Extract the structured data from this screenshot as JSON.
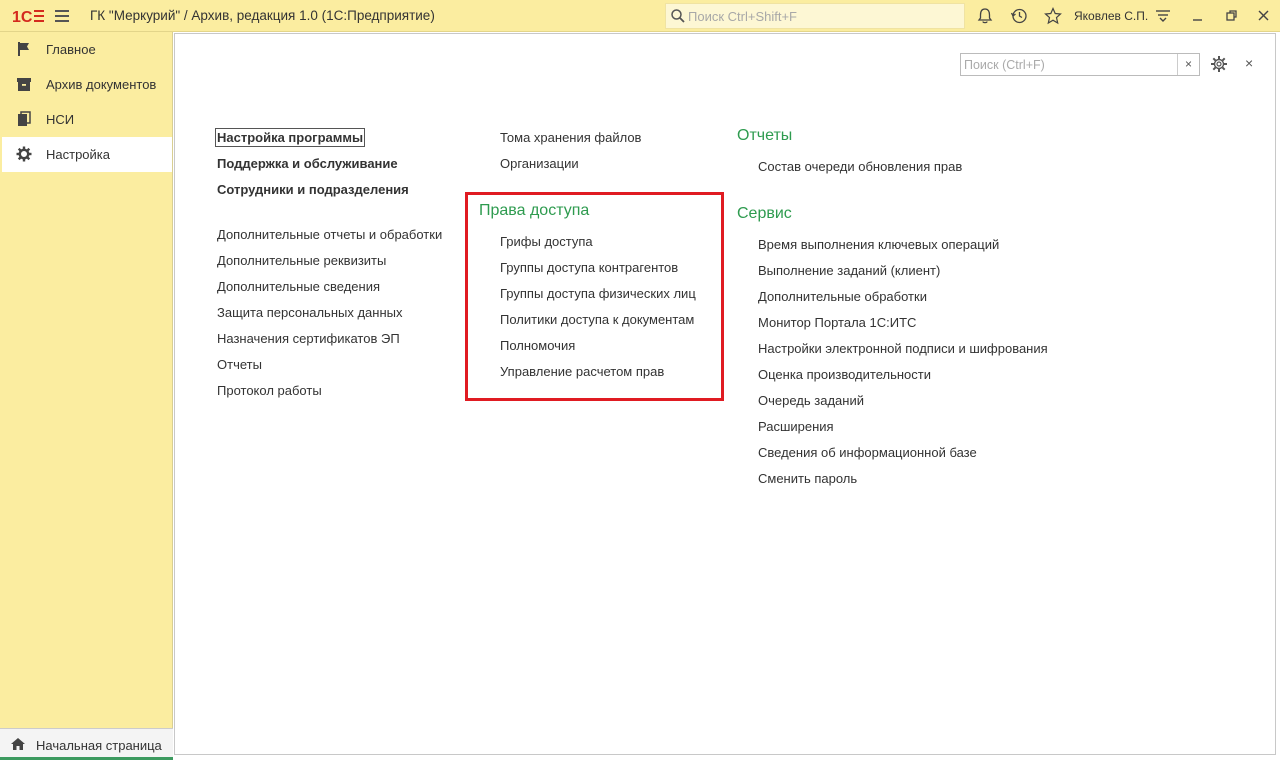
{
  "titlebar": {
    "logo_text": "1С",
    "title": "ГК \"Меркурий\" / Архив, редакция 1.0  (1С:Предприятие)",
    "search_placeholder": "Поиск Ctrl+Shift+F",
    "user_name": "Яковлев С.П."
  },
  "sidebar": {
    "items": [
      {
        "label": "Главное",
        "icon": "flag-icon"
      },
      {
        "label": "Архив документов",
        "icon": "archive-icon"
      },
      {
        "label": "НСИ",
        "icon": "books-icon"
      },
      {
        "label": "Настройка",
        "icon": "gear-icon"
      }
    ],
    "home_label": "Начальная страница"
  },
  "panel": {
    "search_placeholder": "Поиск (Ctrl+F)",
    "clear_label": "×",
    "close_label": "×"
  },
  "col1": {
    "bold_links": [
      "Настройка программы",
      "Поддержка и обслуживание",
      "Сотрудники и подразделения"
    ],
    "links": [
      "Дополнительные отчеты и обработки",
      "Дополнительные реквизиты",
      "Дополнительные сведения",
      "Защита персональных данных",
      "Назначения сертификатов ЭП",
      "Отчеты",
      "Протокол работы"
    ]
  },
  "col2": {
    "links": [
      "Тома хранения файлов",
      "Организации"
    ],
    "access_title": "Права доступа",
    "access_links": [
      "Грифы доступа",
      "Группы доступа контрагентов",
      "Группы доступа физических лиц",
      "Политики доступа к документам",
      "Полномочия",
      "Управление расчетом прав"
    ]
  },
  "col3": {
    "reports_title": "Отчеты",
    "reports_links": [
      "Состав очереди обновления прав"
    ],
    "service_title": "Сервис",
    "service_links": [
      "Время выполнения ключевых операций",
      "Выполнение заданий (клиент)",
      "Дополнительные обработки",
      "Монитор Портала 1С:ИТС",
      "Настройки электронной подписи и шифрования",
      "Оценка производительности",
      "Очередь заданий",
      "Расширения",
      "Сведения об информационной базе",
      "Сменить пароль"
    ]
  },
  "colors": {
    "accent_yellow": "#fbeda0",
    "group_green": "#2e9b4f",
    "highlight_red": "#e01b22"
  }
}
